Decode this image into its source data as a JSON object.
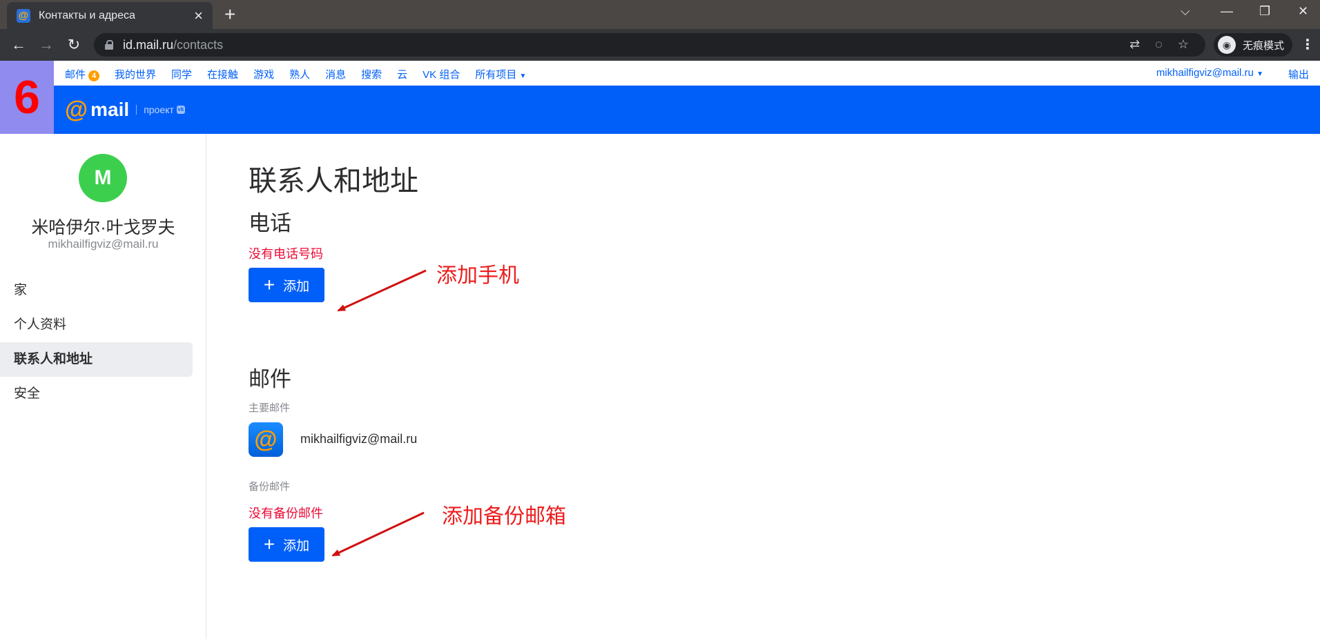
{
  "browser": {
    "tab_title": "Контакты и адреса",
    "url_host": "id.mail.ru",
    "url_path": "/contacts",
    "incognito_label": "无痕模式"
  },
  "portal": {
    "links": [
      "邮件",
      "我的世界",
      "同学",
      "在接触",
      "游戏",
      "熟人",
      "消息",
      "搜索",
      "云",
      "VK 组合",
      "所有项目"
    ],
    "mail_count": "4",
    "account": "mikhailfigviz@mail.ru",
    "logout": "输出"
  },
  "step_number": "6",
  "logo": {
    "word": "mail",
    "project": "проект"
  },
  "profile": {
    "initial": "M",
    "name": "米哈伊尔·叶戈罗夫",
    "email": "mikhailfigviz@mail.ru",
    "avatar_color": "#3ccf4e"
  },
  "sidebar": {
    "items": [
      {
        "label": "家",
        "active": false
      },
      {
        "label": "个人资料",
        "active": false
      },
      {
        "label": "联系人和地址",
        "active": true
      },
      {
        "label": "安全",
        "active": false
      }
    ]
  },
  "main": {
    "title": "联系人和地址",
    "phone": {
      "heading": "电话",
      "empty_note": "没有电话号码",
      "add_label": "添加"
    },
    "mail": {
      "heading": "邮件",
      "primary_label": "主要邮件",
      "primary_email": "mikhailfigviz@mail.ru",
      "backup_label": "备份邮件",
      "backup_empty_note": "没有备份邮件",
      "add_label": "添加"
    }
  },
  "annotations": {
    "add_phone": "添加手机",
    "add_backup": "添加备份邮箱"
  },
  "colors": {
    "brand_blue": "#005ff9",
    "accent_orange": "#ff9e00",
    "warning_red": "#ed0a34",
    "annotation_red": "#ed1c1c"
  }
}
